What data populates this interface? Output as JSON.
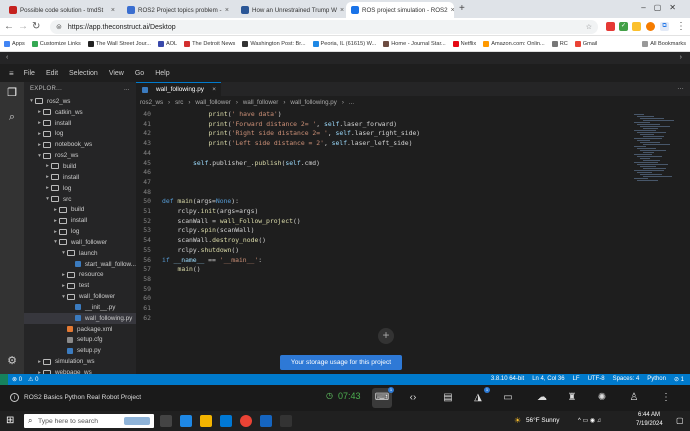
{
  "browser": {
    "tabs": [
      {
        "title": "Possible code solution - tmdSt",
        "color": "#c5221f",
        "active": false
      },
      {
        "title": "ROS2 Project topics problem -",
        "color": "#3a6ed0",
        "active": false
      },
      {
        "title": "How an Unrestrained Trump W",
        "color": "#2b5797",
        "active": false
      },
      {
        "title": "ROS project simulation - ROS2",
        "color": "#1a73e8",
        "active": true
      }
    ],
    "new_tab": "+",
    "url": "https://app.theconstruct.ai/Desktop",
    "bookmarks": [
      "Apps",
      "Customize Links",
      "The Wall Street Jour...",
      "AOL",
      "The Detroit News",
      "Washington Post: Br...",
      "Peoria, IL (61615) W...",
      "Home - Journal Star...",
      "Netflix",
      "Amazon.com: Onlin...",
      "RC",
      "Gmail"
    ],
    "all_bookmarks": "All Bookmarks"
  },
  "ide": {
    "menu": [
      "File",
      "Edit",
      "Selection",
      "View",
      "Go",
      "Help"
    ],
    "explorer_title": "EXPLOR...",
    "tree": [
      {
        "label": "ros2_ws",
        "depth": 0,
        "type": "folder",
        "open": true
      },
      {
        "label": "catkin_ws",
        "depth": 1,
        "type": "folder",
        "open": false
      },
      {
        "label": "install",
        "depth": 1,
        "type": "folder",
        "open": false
      },
      {
        "label": "log",
        "depth": 1,
        "type": "folder",
        "open": false
      },
      {
        "label": "notebook_ws",
        "depth": 1,
        "type": "folder",
        "open": false
      },
      {
        "label": "ros2_ws",
        "depth": 1,
        "type": "folder",
        "open": true
      },
      {
        "label": "build",
        "depth": 2,
        "type": "folder",
        "open": false
      },
      {
        "label": "install",
        "depth": 2,
        "type": "folder",
        "open": false
      },
      {
        "label": "log",
        "depth": 2,
        "type": "folder",
        "open": false
      },
      {
        "label": "src",
        "depth": 2,
        "type": "folder",
        "open": true
      },
      {
        "label": "build",
        "depth": 3,
        "type": "folder",
        "open": false
      },
      {
        "label": "install",
        "depth": 3,
        "type": "folder",
        "open": false
      },
      {
        "label": "log",
        "depth": 3,
        "type": "folder",
        "open": false
      },
      {
        "label": "wall_follower",
        "depth": 3,
        "type": "folder",
        "open": true
      },
      {
        "label": "launch",
        "depth": 4,
        "type": "folder",
        "open": true
      },
      {
        "label": "start_wall_follow...",
        "depth": 5,
        "type": "py",
        "open": false
      },
      {
        "label": "resource",
        "depth": 4,
        "type": "folder",
        "open": false
      },
      {
        "label": "test",
        "depth": 4,
        "type": "folder",
        "open": false
      },
      {
        "label": "wall_follower",
        "depth": 4,
        "type": "folder",
        "open": true
      },
      {
        "label": "__init__.py",
        "depth": 5,
        "type": "py",
        "open": false
      },
      {
        "label": "wall_following.py",
        "depth": 5,
        "type": "py",
        "open": false,
        "selected": true
      },
      {
        "label": "package.xml",
        "depth": 4,
        "type": "xml",
        "open": false
      },
      {
        "label": "setup.cfg",
        "depth": 4,
        "type": "cfg",
        "open": false
      },
      {
        "label": "setup.py",
        "depth": 4,
        "type": "py",
        "open": false
      },
      {
        "label": "simulation_ws",
        "depth": 1,
        "type": "folder",
        "open": false
      },
      {
        "label": "webpage_ws",
        "depth": 1,
        "type": "folder",
        "open": false
      }
    ],
    "editor_tab": "wall_following.py",
    "breadcrumbs": [
      "ros2_ws",
      "src",
      "wall_follower",
      "wall_follower",
      "wall_following.py",
      "..."
    ],
    "code_lines": [
      {
        "n": "40",
        "indent": 3,
        "tokens": [
          [
            "fn",
            "print"
          ],
          [
            "p",
            "("
          ],
          [
            "st",
            "' have data'"
          ],
          [
            "p",
            ")"
          ]
        ]
      },
      {
        "n": "41",
        "indent": 3,
        "tokens": [
          [
            "fn",
            "print"
          ],
          [
            "p",
            "("
          ],
          [
            "st",
            "'Forward distance 2= '"
          ],
          [
            "p",
            ", "
          ],
          [
            "sf",
            "self"
          ],
          [
            "p",
            ".laser_forward)"
          ]
        ]
      },
      {
        "n": "42",
        "indent": 3,
        "tokens": [
          [
            "fn",
            "print"
          ],
          [
            "p",
            "("
          ],
          [
            "st",
            "'Right side distance 2= '"
          ],
          [
            "p",
            ", "
          ],
          [
            "sf",
            "self"
          ],
          [
            "p",
            ".laser_right_side)"
          ]
        ]
      },
      {
        "n": "43",
        "indent": 3,
        "tokens": [
          [
            "fn",
            "print"
          ],
          [
            "p",
            "("
          ],
          [
            "st",
            "'Left side distance = 2'"
          ],
          [
            "p",
            ", "
          ],
          [
            "sf",
            "self"
          ],
          [
            "p",
            ".laser_left_side)"
          ]
        ]
      },
      {
        "n": "44",
        "indent": 0,
        "tokens": []
      },
      {
        "n": "45",
        "indent": 2,
        "tokens": [
          [
            "sf",
            "self"
          ],
          [
            "p",
            ".publisher_."
          ],
          [
            "fn",
            "publish"
          ],
          [
            "p",
            "("
          ],
          [
            "sf",
            "self"
          ],
          [
            "p",
            ".cmd)"
          ]
        ]
      },
      {
        "n": "46",
        "indent": 0,
        "tokens": []
      },
      {
        "n": "47",
        "indent": 0,
        "tokens": []
      },
      {
        "n": "48",
        "indent": 0,
        "tokens": []
      },
      {
        "n": "50",
        "indent": 0,
        "tokens": [
          [
            "kw",
            "def "
          ],
          [
            "fn",
            "main"
          ],
          [
            "p",
            "(args="
          ],
          [
            "kw",
            "None"
          ],
          [
            "p",
            "):"
          ]
        ]
      },
      {
        "n": "51",
        "indent": 1,
        "tokens": [
          [
            "p",
            "rclpy."
          ],
          [
            "fn",
            "init"
          ],
          [
            "p",
            "(args=args)"
          ]
        ]
      },
      {
        "n": "52",
        "indent": 1,
        "tokens": [
          [
            "p",
            "scanWall = "
          ],
          [
            "fn",
            "wall_Follow_project"
          ],
          [
            "p",
            "()"
          ]
        ]
      },
      {
        "n": "53",
        "indent": 1,
        "tokens": [
          [
            "p",
            "rclpy."
          ],
          [
            "fn",
            "spin"
          ],
          [
            "p",
            "(scanWall)"
          ]
        ]
      },
      {
        "n": "54",
        "indent": 1,
        "tokens": [
          [
            "p",
            "scanWall."
          ],
          [
            "fn",
            "destroy_node"
          ],
          [
            "p",
            "()"
          ]
        ]
      },
      {
        "n": "55",
        "indent": 1,
        "tokens": [
          [
            "p",
            "rclpy."
          ],
          [
            "fn",
            "shutdown"
          ],
          [
            "p",
            "()"
          ]
        ]
      },
      {
        "n": "56",
        "indent": 0,
        "tokens": [
          [
            "kw",
            "if "
          ],
          [
            "sf",
            "__name__"
          ],
          [
            "p",
            " == "
          ],
          [
            "st",
            "'__main__'"
          ],
          [
            "p",
            ":"
          ]
        ]
      },
      {
        "n": "57",
        "indent": 1,
        "tokens": [
          [
            "fn",
            "main"
          ],
          [
            "p",
            "()"
          ]
        ]
      },
      {
        "n": "58",
        "indent": 0,
        "tokens": []
      },
      {
        "n": "59",
        "indent": 0,
        "tokens": []
      },
      {
        "n": "60",
        "indent": 0,
        "tokens": []
      },
      {
        "n": "61",
        "indent": 0,
        "tokens": []
      },
      {
        "n": "62",
        "indent": 0,
        "tokens": []
      }
    ],
    "toast": "Your storage usage for this project",
    "status_left": [
      "⊗ 0",
      "⚠ 0"
    ],
    "status_right": [
      "3.8.10 64-bit",
      "Ln 4, Col 36",
      "LF",
      "UTF-8",
      "Spaces: 4",
      "Python",
      "⊘ 1"
    ],
    "project_name": "ROS2 Basics Python Real Robot Project",
    "timer": "07:43",
    "dock_badges": {
      "terminal": "1",
      "gazebo": "1"
    }
  },
  "taskbar": {
    "search_placeholder": "Type here to search",
    "weather": "56°F  Sunny",
    "time": "6:44 AM",
    "date": "7/19/2024"
  }
}
